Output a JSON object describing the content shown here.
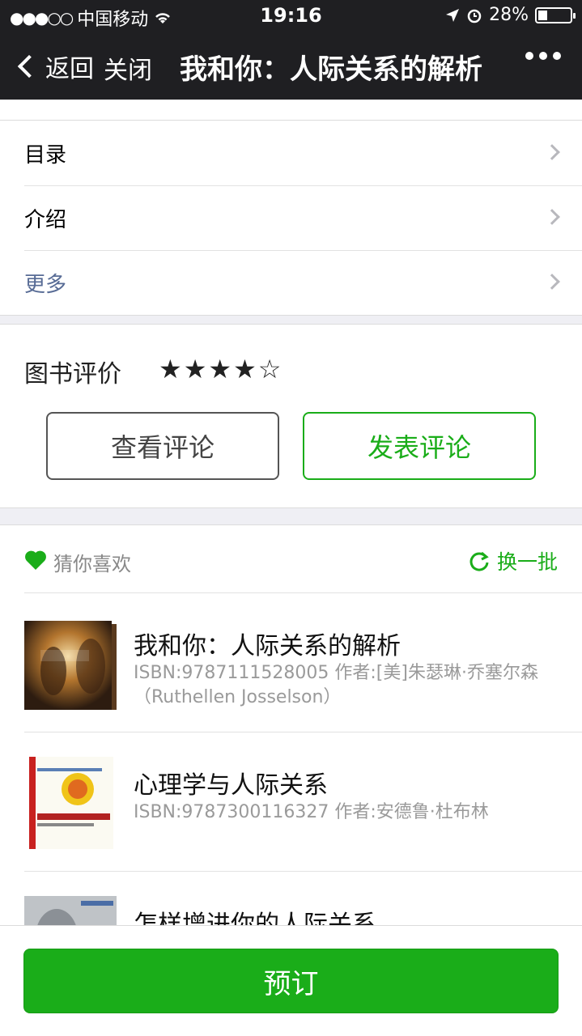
{
  "status_bar": {
    "carrier": "中国移动",
    "time": "19:16",
    "battery_percent": "28%",
    "battery_level": 0.28
  },
  "nav": {
    "back_label": "返回",
    "close_label": "关闭",
    "title": "我和你：人际关系的解析"
  },
  "menu": {
    "items": [
      {
        "label": "目录"
      },
      {
        "label": "介绍"
      },
      {
        "label": "更多"
      }
    ]
  },
  "rating": {
    "label": "图书评价",
    "stars_filled": 4,
    "stars_total": 5,
    "view_label": "查看评论",
    "post_label": "发表评论"
  },
  "recs": {
    "title": "猜你喜欢",
    "refresh_label": "换一批",
    "books": [
      {
        "title": "我和你：人际关系的解析",
        "meta": "ISBN:9787111528005 作者:[美]朱瑟琳·乔塞尔森（Ruthellen Josselson）"
      },
      {
        "title": "心理学与人际关系",
        "meta": "ISBN:9787300116327 作者:安德鲁·杜布林"
      },
      {
        "title": "怎样增进你的人际关系",
        "meta": ""
      }
    ]
  },
  "footer": {
    "order_label": "预订"
  },
  "colors": {
    "header_bg": "#1f1f22",
    "accent_green": "#1aad19",
    "link_blue": "#576b95"
  }
}
